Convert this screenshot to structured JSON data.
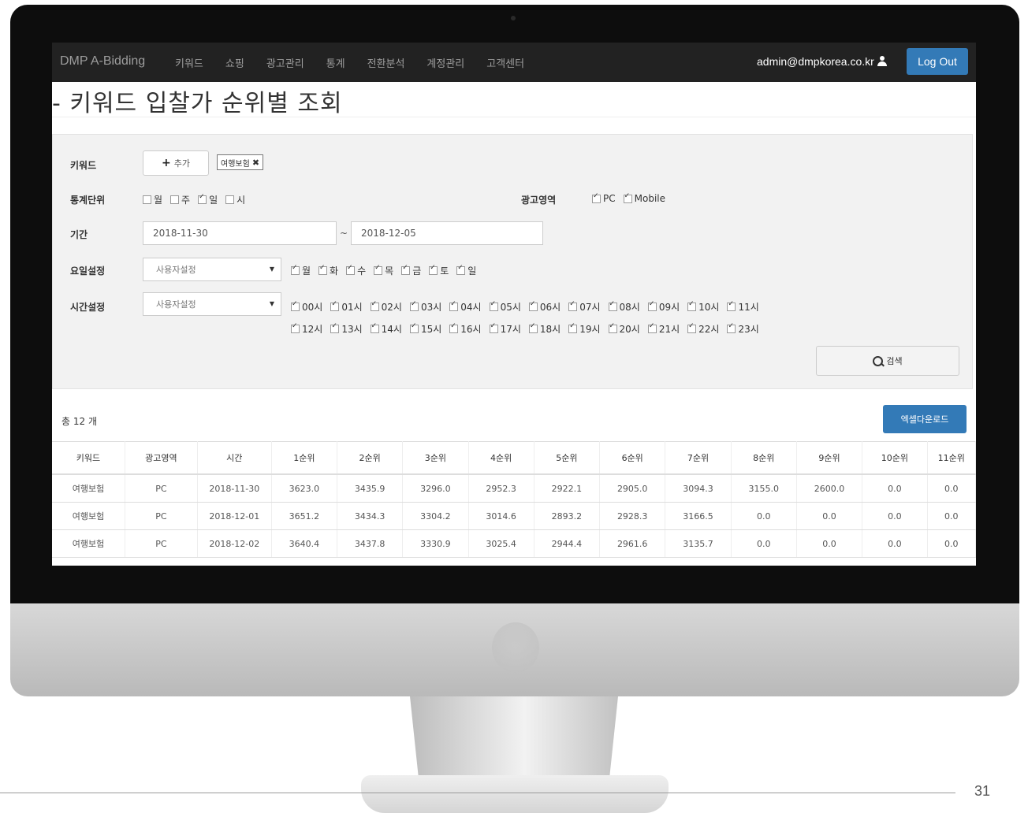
{
  "navbar": {
    "brand": "DMP A-Bidding",
    "items": [
      "키워드",
      "쇼핑",
      "광고관리",
      "통계",
      "전환분석",
      "계정관리",
      "고객센터"
    ],
    "user": "admin@dmpkorea.co.kr",
    "logout": "Log Out"
  },
  "page": {
    "title": "- 키워드 입찰가 순위별 조회",
    "page_number": "31"
  },
  "search": {
    "keyword_label": "키워드",
    "add_button": "추가",
    "keyword_tag": "여행보험",
    "unit_label": "통계단위",
    "units": [
      {
        "label": "월",
        "checked": false
      },
      {
        "label": "주",
        "checked": false
      },
      {
        "label": "일",
        "checked": true
      },
      {
        "label": "시",
        "checked": false
      }
    ],
    "area_label": "광고영역",
    "areas": [
      {
        "label": "PC",
        "checked": true
      },
      {
        "label": "Mobile",
        "checked": true
      }
    ],
    "period_label": "기간",
    "date_from": "2018-11-30",
    "date_sep": "~",
    "date_to": "2018-12-05",
    "weekday_label": "요일설정",
    "weekday_select": "사용자설정",
    "weekdays": [
      "월",
      "화",
      "수",
      "목",
      "금",
      "토",
      "일"
    ],
    "time_label": "시간설정",
    "time_select": "사용자설정",
    "hours_row1": [
      "00시",
      "01시",
      "02시",
      "03시",
      "04시",
      "05시",
      "06시",
      "07시",
      "08시",
      "09시",
      "10시",
      "11시"
    ],
    "hours_row2": [
      "12시",
      "13시",
      "14시",
      "15시",
      "16시",
      "17시",
      "18시",
      "19시",
      "20시",
      "21시",
      "22시",
      "23시"
    ],
    "search_button": "검색"
  },
  "results": {
    "total": "총 12 개",
    "excel_button": "엑셀다운로드",
    "columns": [
      "키워드",
      "광고영역",
      "시간",
      "1순위",
      "2순위",
      "3순위",
      "4순위",
      "5순위",
      "6순위",
      "7순위",
      "8순위",
      "9순위",
      "10순위",
      "11순위"
    ],
    "rows": [
      [
        "여행보험",
        "PC",
        "2018-11-30",
        "3623.0",
        "3435.9",
        "3296.0",
        "2952.3",
        "2922.1",
        "2905.0",
        "3094.3",
        "3155.0",
        "2600.0",
        "0.0",
        "0.0"
      ],
      [
        "여행보험",
        "PC",
        "2018-12-01",
        "3651.2",
        "3434.3",
        "3304.2",
        "3014.6",
        "2893.2",
        "2928.3",
        "3166.5",
        "0.0",
        "0.0",
        "0.0",
        "0.0"
      ],
      [
        "여행보험",
        "PC",
        "2018-12-02",
        "3640.4",
        "3437.8",
        "3330.9",
        "3025.4",
        "2944.4",
        "2961.6",
        "3135.7",
        "0.0",
        "0.0",
        "0.0",
        "0.0"
      ]
    ]
  }
}
